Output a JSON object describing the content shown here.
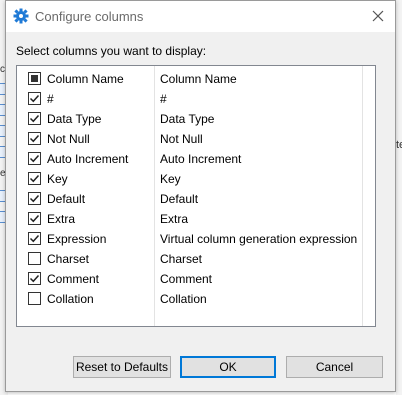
{
  "window": {
    "title": "Configure columns",
    "accent": "#1f7ad6"
  },
  "prompt": "Select columns you want to display:",
  "table": {
    "header": {
      "name": "Column Name",
      "description": "Column Name",
      "state": "mixed"
    },
    "rows": [
      {
        "name": "#",
        "description": "#",
        "checked": true
      },
      {
        "name": "Data Type",
        "description": "Data Type",
        "checked": true
      },
      {
        "name": "Not Null",
        "description": "Not Null",
        "checked": true
      },
      {
        "name": "Auto Increment",
        "description": "Auto Increment",
        "checked": true
      },
      {
        "name": "Key",
        "description": "Key",
        "checked": true
      },
      {
        "name": "Default",
        "description": "Default",
        "checked": true
      },
      {
        "name": "Extra",
        "description": "Extra",
        "checked": true
      },
      {
        "name": "Expression",
        "description": "Virtual column generation expression",
        "checked": true
      },
      {
        "name": "Charset",
        "description": "Charset",
        "checked": false
      },
      {
        "name": "Comment",
        "description": "Comment",
        "checked": true
      },
      {
        "name": "Collation",
        "description": "Collation",
        "checked": false
      }
    ]
  },
  "buttons": {
    "reset": "Reset to Defaults",
    "ok": "OK",
    "cancel": "Cancel"
  },
  "background": {
    "left_fragments": [
      "c",
      "e"
    ],
    "right_fragment": "te"
  }
}
